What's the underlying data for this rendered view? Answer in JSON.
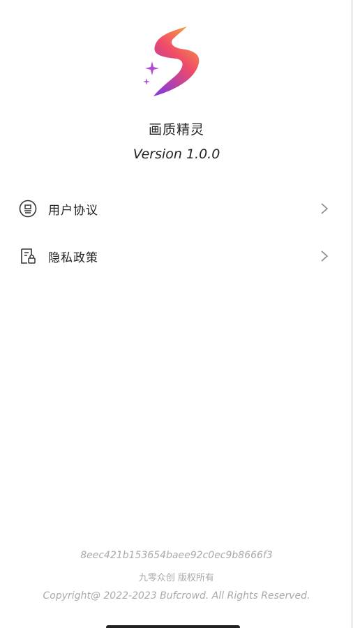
{
  "app": {
    "name": "画质精灵",
    "version": "Version 1.0.0"
  },
  "menu": [
    {
      "label": "用户协议",
      "icon": "user-agreement-icon"
    },
    {
      "label": "隐私政策",
      "icon": "privacy-policy-icon"
    }
  ],
  "footer": {
    "build_hash": "8eec421b153654baee92c0ec9b8666f3",
    "company": "九零众创 版权所有",
    "copyright": "Copyright@ 2022-2023 Bufcrowd. All Rights Reserved."
  },
  "colors": {
    "logo_top": "#f7a23b",
    "logo_mid": "#ef4a6a",
    "logo_bottom": "#8a3bd6",
    "text": "#222222",
    "muted": "#aaaaaa"
  }
}
